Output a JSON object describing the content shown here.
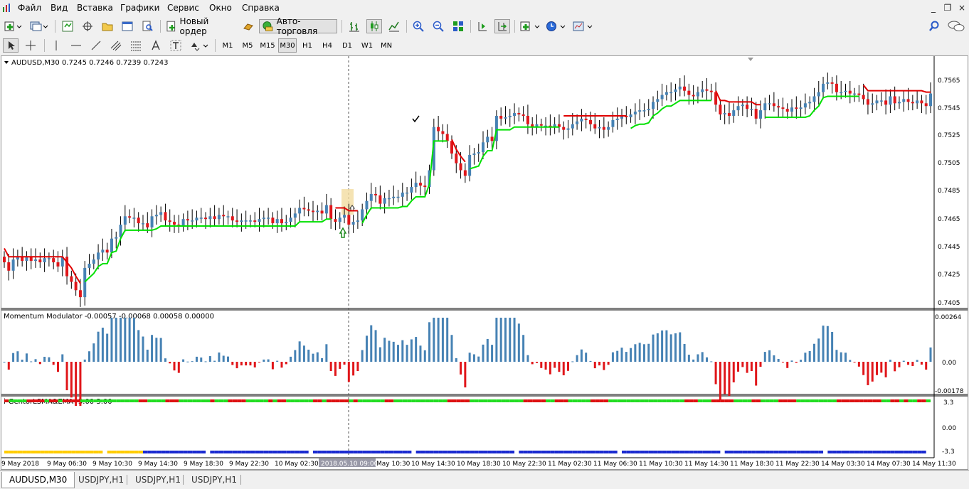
{
  "menu": [
    "Файл",
    "Вид",
    "Вставка",
    "Графики",
    "Сервис",
    "Окно",
    "Справка"
  ],
  "toolbar1": {
    "new_order": "Новый ордер",
    "auto_trading": "Авто-торговля"
  },
  "timeframes": [
    "M1",
    "M5",
    "M15",
    "M30",
    "H1",
    "H4",
    "D1",
    "W1",
    "MN"
  ],
  "active_timeframe": "M30",
  "main_chart": {
    "info": "AUDUSD,M30  0.7245 0.7246 0.7239 0.7243",
    "price_labels": [
      "0.7565",
      "0.7545",
      "0.7525",
      "0.7505",
      "0.7485",
      "0.7465",
      "0.7445",
      "0.7425",
      "0.7405"
    ]
  },
  "momentum": {
    "info": "Momentum Modulator -0.00057 -0.00068 0.00058 0.00000",
    "labels": [
      "0.00264",
      "0.00",
      "-0.00178"
    ]
  },
  "gentor": {
    "info": "i-GentorLSMA&EMA -3.00 3.00",
    "labels": [
      "3.3",
      "0.00",
      "-3.3"
    ]
  },
  "time_labels": [
    "9 May 2018",
    "9 May 06:30",
    "9 May 10:30",
    "9 May 14:30",
    "9 May 18:30",
    "9 May 22:30",
    "10 May 02:30",
    "2018.05.10 09:00",
    "May 10:30",
    "10 May 14:30",
    "10 May 18:30",
    "10 May 22:30",
    "11 May 02:30",
    "11 May 06:30",
    "11 May 10:30",
    "11 May 14:30",
    "11 May 18:30",
    "11 May 22:30",
    "14 May 03:30",
    "14 May 07:30",
    "14 May 11:30"
  ],
  "tabs": [
    "AUDUSD,M30",
    "USDJPY,H1",
    "USDJPY,H1",
    "USDJPY,H1"
  ],
  "colors": {
    "up": "#4682b4",
    "down": "#e0161a",
    "trail_up": "#00e000",
    "trail_down": "#e00000",
    "gentor_green": "#22dd22",
    "gentor_red": "#dd1111",
    "gentor_blue": "#1a2ad0",
    "gentor_yellow": "#ffcc00"
  },
  "chart_data": {
    "type": "candlestick",
    "x_range": [
      "9 May 2018",
      "14 May 11:30"
    ],
    "ylim": [
      0.74,
      0.7575
    ],
    "price_ladder": [
      0.7565,
      0.7545,
      0.7525,
      0.7505,
      0.7485,
      0.7465,
      0.7445,
      0.7425,
      0.7405
    ],
    "closes": [
      0.7433,
      0.7427,
      0.7435,
      0.7437,
      0.7434,
      0.7437,
      0.7434,
      0.7435,
      0.7433,
      0.7436,
      0.7436,
      0.7433,
      0.743,
      0.7437,
      0.7423,
      0.7419,
      0.7413,
      0.7408,
      0.7429,
      0.7432,
      0.7435,
      0.744,
      0.7442,
      0.744,
      0.745,
      0.7451,
      0.746,
      0.7466,
      0.7465,
      0.7465,
      0.7461,
      0.7461,
      0.7458,
      0.7466,
      0.7467,
      0.7469,
      0.7463,
      0.7462,
      0.746,
      0.7459,
      0.7464,
      0.7463,
      0.7463,
      0.7465,
      0.7465,
      0.7464,
      0.7466,
      0.7464,
      0.7467,
      0.7466,
      0.7466,
      0.7463,
      0.7462,
      0.7463,
      0.7463,
      0.7463,
      0.7462,
      0.7464,
      0.7465,
      0.7465,
      0.7461,
      0.7464,
      0.7461,
      0.7462,
      0.7465,
      0.7468,
      0.7472,
      0.7471,
      0.747,
      0.7469,
      0.747,
      0.7468,
      0.7474,
      0.7464,
      0.7462,
      0.7465,
      0.7467,
      0.746,
      0.7462,
      0.7463,
      0.7471,
      0.7477,
      0.7482,
      0.7481,
      0.7475,
      0.7479,
      0.7479,
      0.748,
      0.748,
      0.7483,
      0.7483,
      0.7487,
      0.749,
      0.7488,
      0.7487,
      0.7499,
      0.753,
      0.7527,
      0.7525,
      0.752,
      0.7511,
      0.7504,
      0.7499,
      0.7495,
      0.751,
      0.7511,
      0.7512,
      0.7519,
      0.7523,
      0.752,
      0.7538,
      0.7536,
      0.7537,
      0.7538,
      0.754,
      0.7539,
      0.7538,
      0.7532,
      0.753,
      0.7532,
      0.7531,
      0.7531,
      0.753,
      0.7532,
      0.753,
      0.7528,
      0.7529,
      0.7532,
      0.7534,
      0.7536,
      0.7535,
      0.7532,
      0.7529,
      0.753,
      0.7528,
      0.753,
      0.7535,
      0.7536,
      0.7538,
      0.7537,
      0.7539,
      0.7541,
      0.7542,
      0.7542,
      0.7543,
      0.7548,
      0.755,
      0.7553,
      0.7555,
      0.7555,
      0.7557,
      0.7559,
      0.7556,
      0.7553,
      0.7552,
      0.7555,
      0.7557,
      0.7556,
      0.7555,
      0.7546,
      0.7539,
      0.754,
      0.7538,
      0.7542,
      0.7545,
      0.7546,
      0.7543,
      0.7543,
      0.7536,
      0.7542,
      0.7547,
      0.7547,
      0.7545,
      0.7544,
      0.7543,
      0.7541,
      0.7544,
      0.7543,
      0.7544,
      0.7547,
      0.7548,
      0.7552,
      0.7555,
      0.7561,
      0.7562,
      0.7561,
      0.7555,
      0.7555,
      0.7556,
      0.7554,
      0.7554,
      0.7553,
      0.755,
      0.7546,
      0.7547,
      0.7549,
      0.7549,
      0.7546,
      0.7552,
      0.7547,
      0.7548,
      0.755,
      0.7548,
      0.7547,
      0.7549,
      0.7547,
      0.7545,
      0.7554
    ]
  }
}
